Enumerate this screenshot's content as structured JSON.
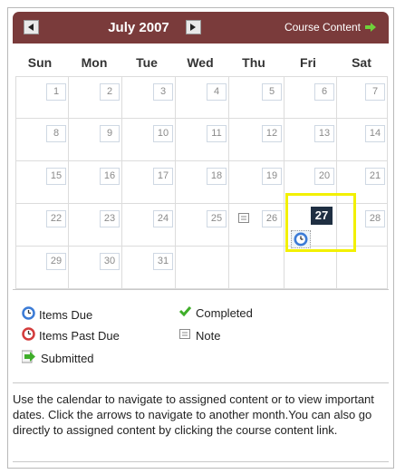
{
  "header": {
    "month": "July 2007",
    "course_link": "Course Content",
    "prev_icon": "triangle-left-icon",
    "next_icon": "triangle-right-icon",
    "link_icon": "green-arrow-right-icon",
    "bar_color": "#7a3b3b"
  },
  "weekdays": [
    "Sun",
    "Mon",
    "Tue",
    "Wed",
    "Thu",
    "Fri",
    "Sat"
  ],
  "weeks": [
    [
      "1",
      "2",
      "3",
      "4",
      "5",
      "6",
      "7"
    ],
    [
      "8",
      "9",
      "10",
      "11",
      "12",
      "13",
      "14"
    ],
    [
      "15",
      "16",
      "17",
      "18",
      "19",
      "20",
      "21"
    ],
    [
      "22",
      "23",
      "24",
      "25",
      "26",
      "27",
      "28"
    ],
    [
      "29",
      "30",
      "31",
      "",
      "",
      "",
      ""
    ]
  ],
  "selected_day": "27",
  "note_day": "26",
  "due_day": "27",
  "legend": {
    "items_due": "Items Due",
    "items_past_due": "Items Past Due",
    "submitted": "Submitted",
    "completed": "Completed",
    "note": "Note"
  },
  "help_text": "Use the calendar to navigate to assigned content or to view important dates. Click the arrows to navigate to another month.You can also go directly to assigned content by clicking the course content link.",
  "colors": {
    "selected_day": "#1f2f42",
    "highlight": "#f2f000",
    "green": "#3fae2a"
  }
}
